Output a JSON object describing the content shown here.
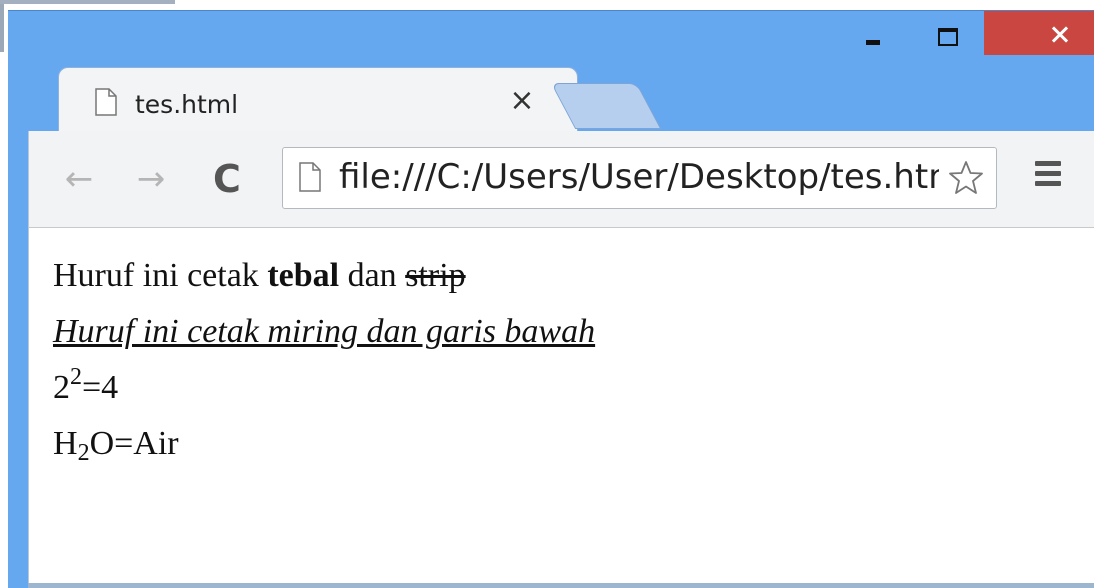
{
  "window": {
    "controls": {
      "minimize": "minimize",
      "maximize": "maximize",
      "close": "close"
    },
    "close_color": "#c94641",
    "frame_color": "#66a8f0"
  },
  "tabs": [
    {
      "title": "tes.html",
      "icon": "page-icon",
      "close_glyph": "×",
      "active": true
    },
    {
      "title": "",
      "icon": "",
      "active": false
    }
  ],
  "toolbar": {
    "back_glyph": "←",
    "forward_glyph": "→",
    "reload_glyph": "C",
    "url": "file:///C:/Users/User/Desktop/tes.html",
    "bookmark_icon": "star-icon",
    "menu_icon": "hamburger-menu-icon"
  },
  "content": {
    "line1": {
      "prefix": "Huruf ini cetak ",
      "bold": "tebal",
      "middle": " dan ",
      "strike": "strip"
    },
    "line2": {
      "italic_underline": "Huruf ini cetak miring dan garis bawah"
    },
    "line3": {
      "base": "2",
      "superscript": "2",
      "rest": "=4"
    },
    "line4": {
      "base": "H",
      "subscript": "2",
      "rest": "O=Air"
    }
  }
}
